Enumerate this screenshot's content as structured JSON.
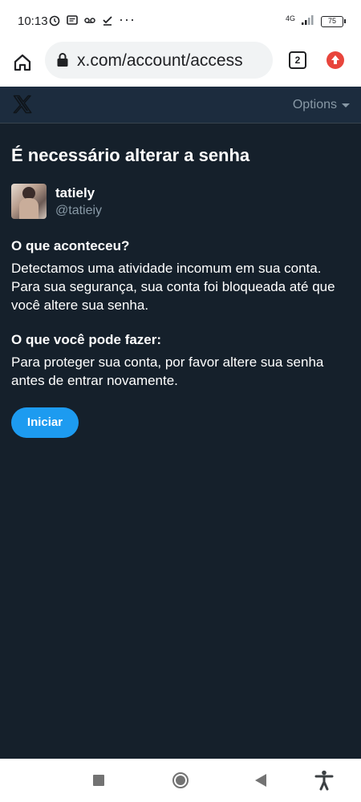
{
  "status_bar": {
    "time": "10:13",
    "more": "···",
    "network": "4G",
    "battery": "75"
  },
  "browser": {
    "url": "x.com/account/access",
    "tab_count": "2"
  },
  "header": {
    "options_label": "Options"
  },
  "main": {
    "title": "É necessário alterar a senha",
    "user": {
      "display_name": "tatiely",
      "handle": "@tatieiy"
    },
    "what_happened": {
      "heading": "O que aconteceu?",
      "text": "Detectamos uma atividade incomum em sua conta. Para sua segurança, sua conta foi bloqueada até que você altere sua senha."
    },
    "what_you_can_do": {
      "heading": "O que você pode fazer:",
      "text": "Para proteger sua conta, por favor altere sua senha antes de entrar novamente."
    },
    "start_button": "Iniciar"
  },
  "colors": {
    "background": "#15202b",
    "accent": "#1d9bf0",
    "muted_text": "#8899a6"
  }
}
